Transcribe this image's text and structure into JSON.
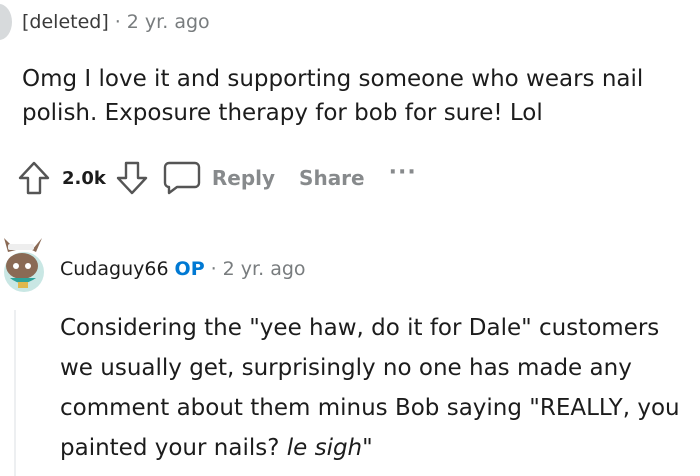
{
  "comments": [
    {
      "author": "[deleted]",
      "separator": "·",
      "time": "2 yr. ago",
      "body": "Omg I love it and supporting someone who wears nail polish. Exposure therapy for bob for sure! Lol",
      "score": "2.0k",
      "actions": {
        "reply": "Reply",
        "share": "Share",
        "more": "···"
      }
    },
    {
      "author": "Cudaguy66",
      "badge": "OP",
      "separator": "·",
      "time": "2 yr. ago",
      "body_main": "Considering the \"yee haw, do it for Dale\" customers we usually get, surprisingly no one has made any comment about them minus Bob saying \"REALLY, you painted your nails? ",
      "body_italic": "le sigh",
      "body_end": "\""
    }
  ],
  "colors": {
    "op_badge": "#0079d3",
    "meta": "#787c7e",
    "action": "#878a8c"
  },
  "icons": [
    "upvote-icon",
    "downvote-icon",
    "comment-bubble-icon",
    "more-icon"
  ]
}
